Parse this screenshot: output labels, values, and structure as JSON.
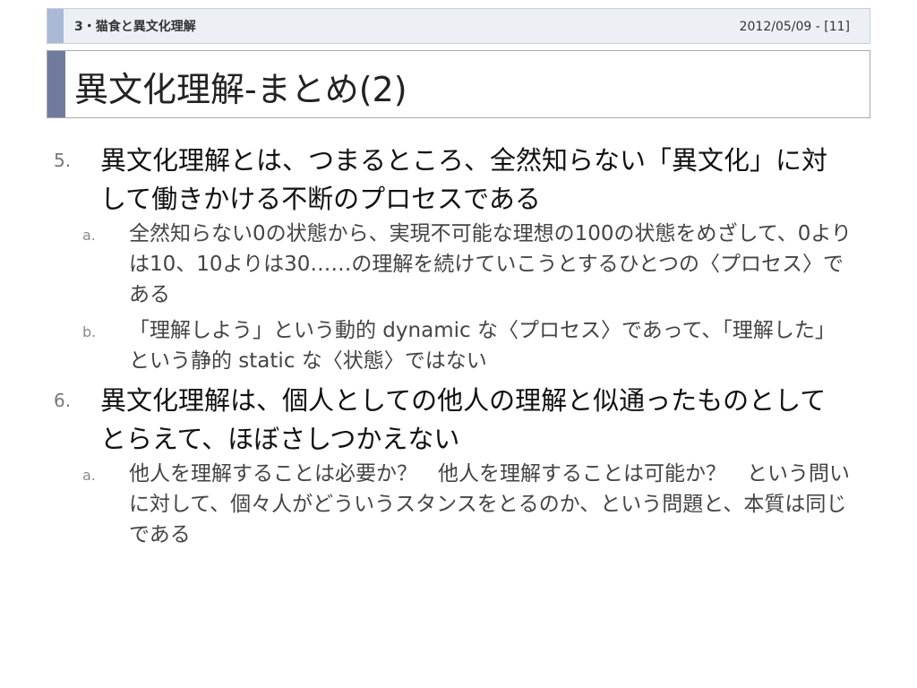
{
  "header": {
    "section": "3・猫食と異文化理解",
    "date": "2012/05/09 - [11]"
  },
  "title": "異文化理解-まとめ(2)",
  "items": [
    {
      "number": "5.",
      "text": "異文化理解とは、つまるところ、全然知らない「異文化」に対して働きかける不断のプロセスである",
      "subs": [
        {
          "letter": "a.",
          "text": "全然知らない0の状態から、実現不可能な理想の100の状態をめざして、0よりは10、10よりは30……の理解を続けていこうとするひとつの〈プロセス〉である"
        },
        {
          "letter": "b.",
          "text": "「理解しよう」という動的 dynamic な〈プロセス〉であって、「理解した」という静的 static な〈状態〉ではない"
        }
      ]
    },
    {
      "number": "6.",
      "text": "異文化理解は、個人としての他人の理解と似通ったものとしてとらえて、ほぼさしつかえない",
      "subs": [
        {
          "letter": "a.",
          "text": "他人を理解することは必要か？　他人を理解することは可能か？　という問いに対して、個々人がどういうスタンスをとるのか、という問題と、本質は同じである"
        }
      ]
    }
  ]
}
